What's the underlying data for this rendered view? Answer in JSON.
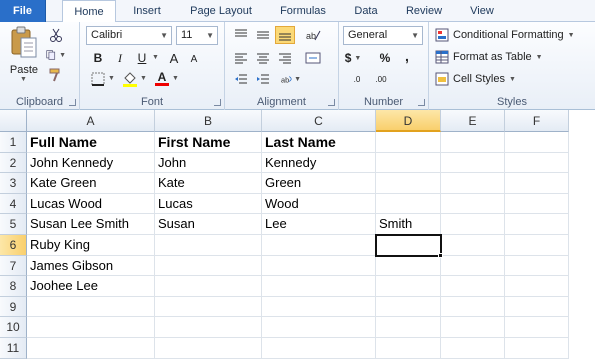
{
  "tabs": {
    "file": "File",
    "home": "Home",
    "insert": "Insert",
    "page_layout": "Page Layout",
    "formulas": "Formulas",
    "data": "Data",
    "review": "Review",
    "view": "View"
  },
  "ribbon": {
    "clipboard": {
      "label": "Clipboard",
      "paste_label": "Paste"
    },
    "font": {
      "label": "Font",
      "font_name": "Calibri",
      "font_size": "11",
      "bold": "B",
      "italic": "I",
      "underline": "U",
      "grow": "A",
      "shrink": "A",
      "font_color": "A"
    },
    "alignment": {
      "label": "Alignment"
    },
    "number": {
      "label": "Number",
      "format": "General",
      "currency": "$",
      "percent": "%",
      "comma": ",",
      "inc_decimal": ".0",
      "dec_decimal": ".00"
    },
    "styles": {
      "label": "Styles",
      "conditional": "Conditional Formatting",
      "format_table": "Format as Table",
      "cell_styles": "Cell Styles"
    }
  },
  "sheet": {
    "columns": [
      "A",
      "B",
      "C",
      "D",
      "E",
      "F"
    ],
    "rows": [
      "1",
      "2",
      "3",
      "4",
      "5",
      "6",
      "7",
      "8",
      "9",
      "10",
      "11"
    ],
    "cells": {
      "A1": "Full Name",
      "B1": "First Name",
      "C1": "Last Name",
      "A2": "John Kennedy",
      "B2": "John",
      "C2": "Kennedy",
      "A3": "Kate Green",
      "B3": "Kate",
      "C3": "Green",
      "A4": "Lucas Wood",
      "B4": "Lucas",
      "C4": "Wood",
      "A5": "Susan Lee Smith",
      "B5": "Susan",
      "C5": "Lee",
      "D5": "Smith",
      "A6": "Ruby King",
      "A7": "James Gibson",
      "A8": "Joohee Lee"
    },
    "active_cell": "D6",
    "colors": {
      "accent": "#2a6fc9",
      "selected_header": "#f9cf6c"
    }
  }
}
